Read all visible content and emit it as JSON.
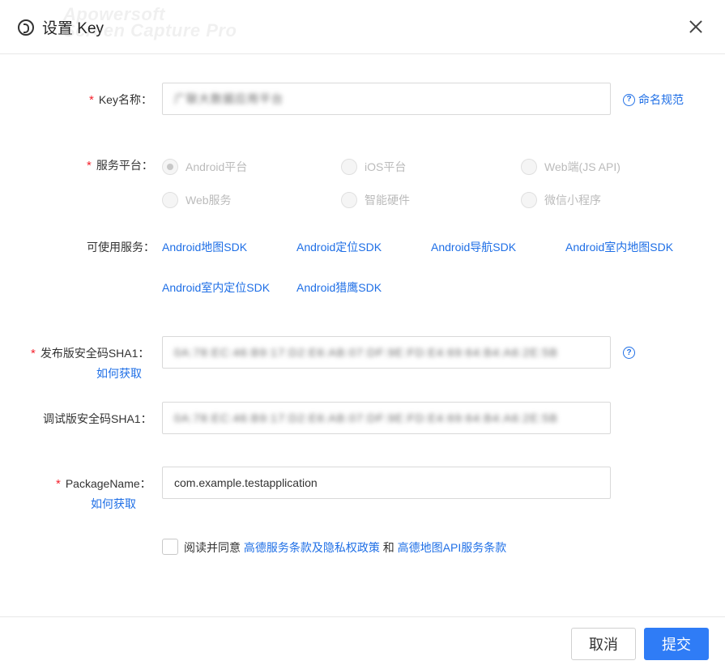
{
  "dialog": {
    "title": "设置 Key",
    "watermark": "Apowersoft\nScreen Capture Pro"
  },
  "key_name": {
    "label": "Key名称：",
    "value": "广联大数据应用平台",
    "help_link": "命名规范"
  },
  "platform": {
    "label": "服务平台：",
    "options": [
      {
        "label": "Android平台",
        "checked": true
      },
      {
        "label": "iOS平台",
        "checked": false
      },
      {
        "label": "Web端(JS API)",
        "checked": false
      },
      {
        "label": "Web服务",
        "checked": false
      },
      {
        "label": "智能硬件",
        "checked": false
      },
      {
        "label": "微信小程序",
        "checked": false
      }
    ]
  },
  "services": {
    "label": "可使用服务：",
    "items": [
      "Android地图SDK",
      "Android定位SDK",
      "Android导航SDK",
      "Android室内地图SDK",
      "Android室内定位SDK",
      "Android猎鹰SDK"
    ]
  },
  "release_sha1": {
    "label": "发布版安全码SHA1：",
    "value": "0A:78:EC:46:B9:17:D2:E6:AB:07:DF:9E:FD:E4:69:64:B4:A6:2E:5B",
    "how_link": "如何获取"
  },
  "debug_sha1": {
    "label": "调试版安全码SHA1：",
    "value": "0A:78:EC:46:B9:17:D2:E6:AB:07:DF:9E:FD:E4:69:64:B4:A6:2E:5B"
  },
  "package_name": {
    "label": "PackageName：",
    "value": "com.example.testapplication",
    "how_link": "如何获取"
  },
  "agreement": {
    "prefix": "阅读并同意",
    "link1": "高德服务条款及隐私权政策",
    "and": "和",
    "link2": "高德地图API服务条款"
  },
  "footer": {
    "cancel": "取消",
    "submit": "提交"
  },
  "colors": {
    "link": "#1f6fe6",
    "primary": "#2f7cf6",
    "required": "#f5222d"
  }
}
